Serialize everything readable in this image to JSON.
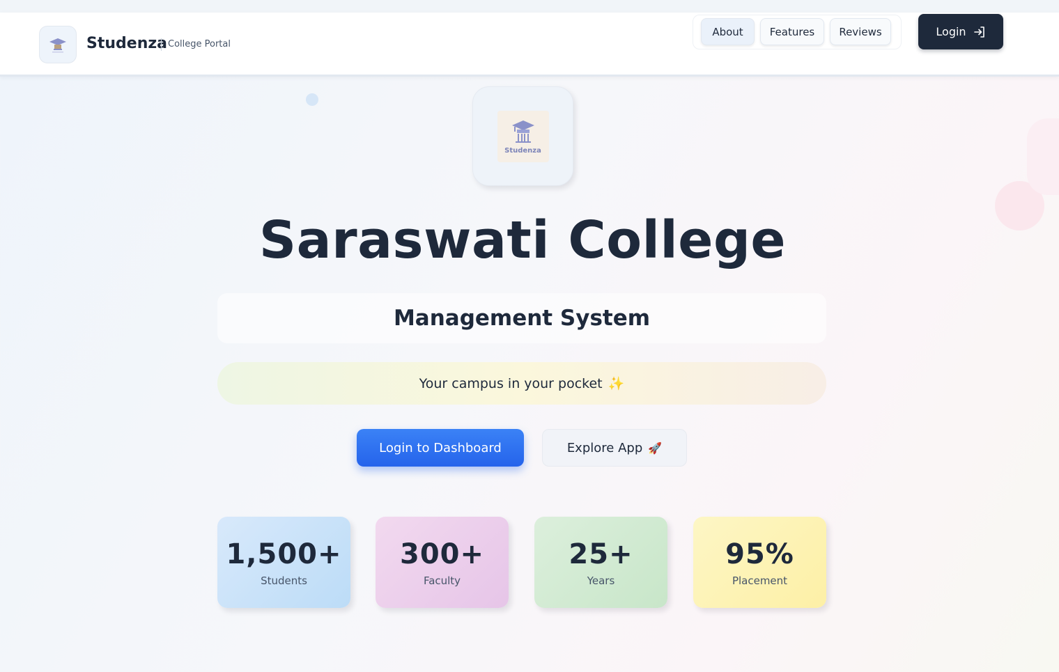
{
  "navbar": {
    "brand_name": "Studenza",
    "brand_subtitle": "College Portal",
    "links": [
      "About",
      "Features",
      "Reviews"
    ],
    "login_label": "Login"
  },
  "hero": {
    "logo_text": "Studenza",
    "title": "Saraswati College",
    "subtitle": "Management System",
    "tagline": "Your campus in your pocket",
    "tagline_emoji": "✨",
    "primary_button": "Login to Dashboard",
    "secondary_button": "Explore App",
    "secondary_emoji": "🚀"
  },
  "stats": [
    {
      "value": "1,500+",
      "label": "Students"
    },
    {
      "value": "300+",
      "label": "Faculty"
    },
    {
      "value": "25+",
      "label": "Years"
    },
    {
      "value": "95%",
      "label": "Placement"
    }
  ],
  "colors": {
    "primary": "#2563eb",
    "dark": "#1e293b"
  }
}
